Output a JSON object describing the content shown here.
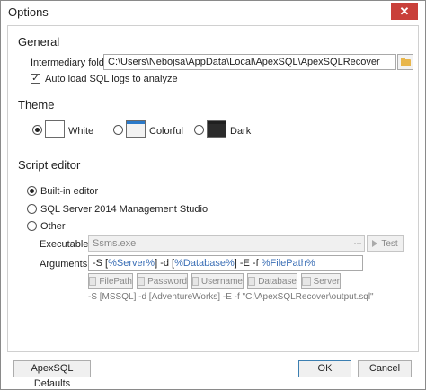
{
  "window": {
    "title": "Options",
    "close_glyph": "✕"
  },
  "general": {
    "heading": "General",
    "folder_label": "Intermediary folder:",
    "folder_value": "C:\\Users\\Nebojsa\\AppData\\Local\\ApexSQL\\ApexSQLRecover",
    "autoload_label": "Auto load SQL logs to analyze",
    "autoload_checked": true,
    "check_glyph": "✓"
  },
  "theme": {
    "heading": "Theme",
    "options": [
      {
        "label": "White",
        "selected": true,
        "bar_color": "#ffffff",
        "body_color": "#ffffff"
      },
      {
        "label": "Colorful",
        "selected": false,
        "bar_color": "#2a79c9",
        "body_color": "#f2f2f2"
      },
      {
        "label": "Dark",
        "selected": false,
        "bar_color": "#1f1f1f",
        "body_color": "#2b2b2b"
      }
    ]
  },
  "script_editor": {
    "heading": "Script editor",
    "options": [
      {
        "label": "Built-in editor",
        "selected": true
      },
      {
        "label": "SQL Server 2014 Management Studio",
        "selected": false
      },
      {
        "label": "Other",
        "selected": false
      }
    ],
    "executable_label": "Executable:",
    "executable_value": "Ssms.exe",
    "dots_label": "···",
    "test_label": "Test",
    "arguments_label": "Arguments:",
    "arguments_parts": [
      "-S [",
      "%Server%",
      "] -d [",
      "%Database%",
      "] -E -f ",
      "%FilePath%"
    ],
    "token_buttons": [
      "FilePath",
      "Password",
      "Username",
      "Database",
      "Server"
    ],
    "preview": "-S [MSSQL] -d [AdventureWorks] -E -f \"C:\\ApexSQLRecover\\output.sql\""
  },
  "footer": {
    "defaults_label": "ApexSQL Defaults",
    "ok_label": "OK",
    "cancel_label": "Cancel"
  },
  "colors": {
    "close": "#c9403a",
    "token_text": "#3b6fb6",
    "default_button_border": "#3c7fb1"
  }
}
